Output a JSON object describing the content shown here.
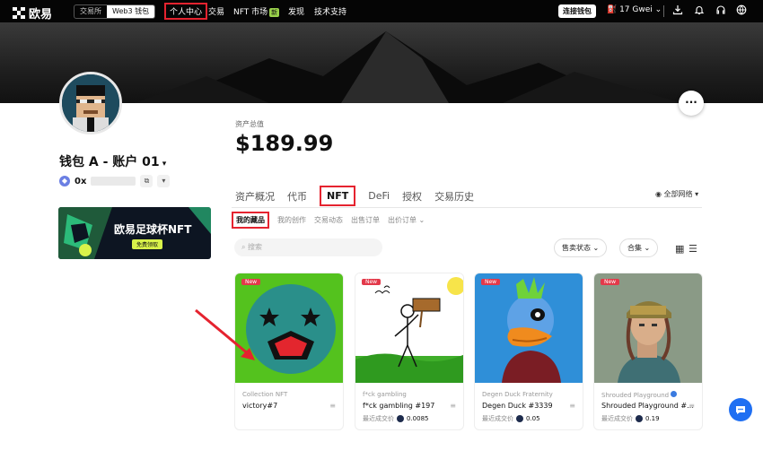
{
  "topbar": {
    "logo_text": "欧易",
    "segment": [
      "交易所",
      "Web3 钱包"
    ],
    "nav": [
      "个人中心",
      "交易",
      "NFT 市场",
      "发现",
      "技术支持"
    ],
    "nft_badge": "新",
    "connect": "连接钱包",
    "gas": "17 Gwei",
    "icons": [
      "download-icon",
      "bell-icon",
      "headset-icon",
      "globe-icon"
    ]
  },
  "profile": {
    "wallet_name": "钱包 A - 账户 01",
    "address_prefix": "0x",
    "more": "···"
  },
  "promo": {
    "title": "欧易足球杯NFT",
    "button": "免费领取"
  },
  "assets": {
    "label": "资产总值",
    "value": "$189.99"
  },
  "tabs": [
    "资产概况",
    "代币",
    "NFT",
    "DeFi",
    "授权",
    "交易历史"
  ],
  "network": "全部网络",
  "subtabs": [
    "我的藏品",
    "我的创作",
    "交易动态",
    "出售订单",
    "出价订单"
  ],
  "filters": {
    "search_placeholder": "搜索",
    "sale_status": "售卖状态",
    "collection": "合集"
  },
  "cards": [
    {
      "badge": "New",
      "collection": "Collection NFT",
      "name": "victory#7",
      "last_label": "",
      "price": ""
    },
    {
      "badge": "New",
      "collection": "f*ck gambling",
      "name": "f*ck gambling #197",
      "last_label": "最近成交价",
      "price": "0.0085"
    },
    {
      "badge": "New",
      "collection": "Degen Duck Fraternity",
      "name": "Degen Duck #3339",
      "last_label": "最近成交价",
      "price": "0.05"
    },
    {
      "badge": "New",
      "collection": "Shrouded Playground",
      "name": "Shrouded Playground #...",
      "last_label": "最近成交价",
      "price": "0.19"
    }
  ],
  "colors": {
    "highlight_red": "#e5232f",
    "chat_blue": "#1f6ff2",
    "card_green": "#54c21e"
  }
}
